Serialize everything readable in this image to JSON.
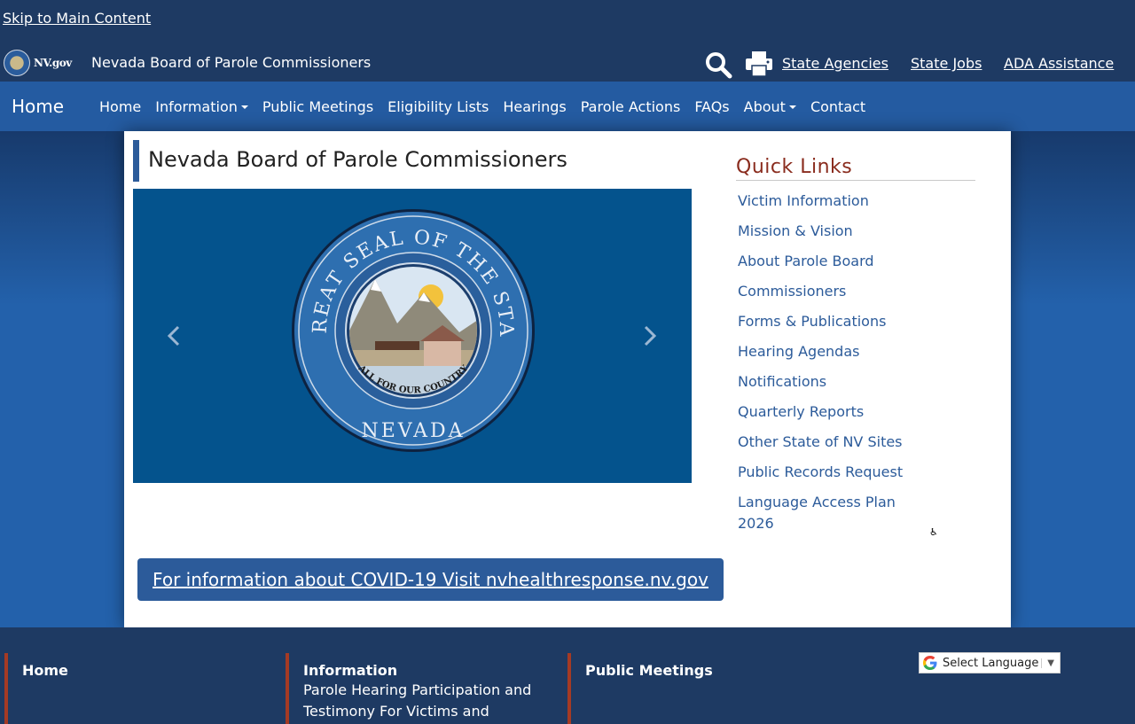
{
  "header": {
    "skip_link": "Skip to Main Content",
    "logo_text": "NV.gov",
    "site_title": "Nevada Board of Parole Commissioners",
    "links": [
      "State Agencies",
      "State Jobs",
      "ADA Assistance"
    ]
  },
  "nav": {
    "brand": "Home",
    "items": [
      {
        "label": "Home"
      },
      {
        "label": "Information",
        "dropdown": true
      },
      {
        "label": "Public Meetings"
      },
      {
        "label": "Eligibility Lists"
      },
      {
        "label": "Hearings"
      },
      {
        "label": "Parole Actions"
      },
      {
        "label": "FAQs"
      },
      {
        "label": "About",
        "dropdown": true
      },
      {
        "label": "Contact"
      }
    ]
  },
  "main": {
    "page_title": "Nevada Board of Parole Commissioners",
    "carousel": {
      "seal_top_text": "THE GREAT SEAL OF THE STATE OF",
      "seal_bottom_text": "NEVADA",
      "seal_motto": "ALL FOR OUR COUNTRY"
    },
    "covid_link": "For information about COVID-19 Visit nvhealthresponse.nv.gov"
  },
  "quick_links": {
    "title": "Quick Links",
    "items": [
      "Victim Information",
      "Mission & Vision",
      "About Parole Board",
      "Commissioners",
      "Forms & Publications",
      "Hearing Agendas",
      "Notifications",
      "Quarterly Reports",
      "Other State of NV Sites",
      "Public Records Request",
      "Language Access Plan 2026"
    ]
  },
  "footer": {
    "columns": [
      {
        "title": "Home",
        "text": ""
      },
      {
        "title": "Information",
        "text": "Parole Hearing Participation and Testimony For Victims and"
      },
      {
        "title": "Public Meetings",
        "text": ""
      }
    ],
    "translate": "Select Language"
  },
  "colors": {
    "header_bg": "#1e3a63",
    "nav_bg": "#245ba1",
    "accent": "#2c5b9a",
    "quick_links_title": "#8a2c1e",
    "footer_border": "#a53a24"
  },
  "icons": [
    "search-icon",
    "print-icon",
    "chevron-left-icon",
    "chevron-right-icon",
    "accessibility-icon",
    "google-icon"
  ]
}
